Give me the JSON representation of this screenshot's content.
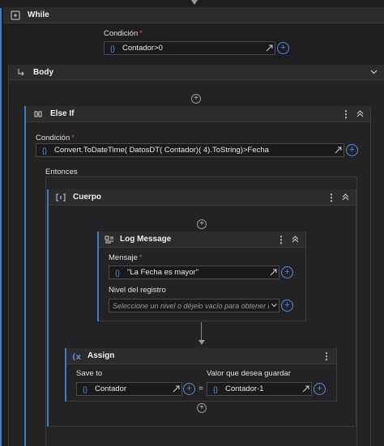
{
  "while": {
    "title": "While",
    "condition_label": "Condición",
    "required_mark": "*",
    "condition_value": "Contador>0"
  },
  "body": {
    "title": "Body"
  },
  "elseif": {
    "title": "Else If",
    "condition_label": "Condición",
    "required_mark": "*",
    "condition_value": "Convert.ToDateTime( DatosDT( Contador)( 4).ToString)>Fecha",
    "then_label": "Entonces"
  },
  "cuerpo": {
    "title": "Cuerpo"
  },
  "log_message": {
    "title": "Log Message",
    "message_label": "Mensaje",
    "required_mark": "*",
    "message_value": "\"La Fecha es mayor\"",
    "level_label": "Nivel del registro",
    "level_placeholder": "Seleccione un nivel o déjelo vacío para obtener in"
  },
  "assign": {
    "title": "Assign",
    "save_to_label": "Save to",
    "value_label": "Valor que desea guardar",
    "save_to_value": "Contador",
    "equals": "=",
    "value_value": "Contador-1"
  },
  "glyphs": {
    "brace": "{}",
    "plus": "+",
    "kebab": "⋮",
    "add": "+"
  },
  "icons": [
    "while-icon",
    "body-arrow-icon",
    "elseif-icon",
    "cuerpo-icon",
    "log-message-icon",
    "assign-icon",
    "expand-icon",
    "plus-icon",
    "kebab-icon",
    "collapse-icon"
  ],
  "colors": {
    "accent": "#4f8fe6",
    "required": "#d9534f",
    "background": "#1e1e1e"
  }
}
